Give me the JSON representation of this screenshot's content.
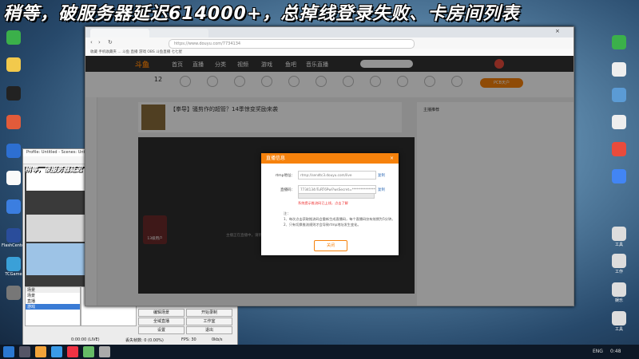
{
  "overlay": {
    "title": "稍等，破服务器延迟614000+，总掉线登录失败、卡房间列表",
    "small_title": "稍等，破服务器延迟"
  },
  "desktop_icons": [
    {
      "label": ""
    },
    {
      "label": ""
    },
    {
      "label": ""
    },
    {
      "label": ""
    },
    {
      "label": ""
    },
    {
      "label": ""
    },
    {
      "label": ""
    },
    {
      "label": ""
    },
    {
      "label": "FlashCenter"
    },
    {
      "label": "TCGame"
    }
  ],
  "desktop_icons_right": [
    {
      "label": ""
    },
    {
      "label": ""
    },
    {
      "label": ""
    },
    {
      "label": ""
    },
    {
      "label": ""
    },
    {
      "label": ""
    },
    {
      "label": "工具"
    },
    {
      "label": "工作"
    },
    {
      "label": "娱乐"
    },
    {
      "label": "工具"
    }
  ],
  "obs": {
    "title": "Profile: Untitled - Scenes: Untitled",
    "scenes_header": "场景",
    "scene_items": [
      "场景",
      "直播",
      "游戏"
    ],
    "buttons": [
      "编辑场景",
      "开始录制",
      "全域直播",
      "工作室",
      "设置",
      "退出"
    ],
    "status": [
      "0:00:00 (LIVE)",
      "丢失帧数: 0 (0.00%)",
      "FPS: 30",
      "0kb/s"
    ]
  },
  "browser": {
    "url": "https://www.douyu.com/7734134",
    "tab_label": "",
    "bookmarks": "收藏  手机收藏夹  ...  斗鱼  直播  游戏  OBS  斗鱼直播  七七星",
    "nav": {
      "logo": "斗鱼",
      "links": [
        "首页",
        "直播",
        "分类",
        "视频",
        "游戏",
        "鱼吧",
        "音乐直播"
      ]
    },
    "categories": [
      "12",
      "",
      "",
      "",
      "",
      "",
      "",
      "",
      "",
      "",
      "",
      "",
      "",
      "",
      "",
      ""
    ],
    "stream_title": "【拳导】骚剪作的超管？14季惊变奖励来袭",
    "chat_header": "主播推荐",
    "right_pill": "PCB天户",
    "video_watermark": "主播正在直播中，请稍后刷新",
    "badge": "13级用户"
  },
  "dialog": {
    "title": "直播信息",
    "close_icon": "×",
    "rtmp_label": "rtmp地址：",
    "rtmp_value": "rtmp://sendtc3.douyu.com/live",
    "key_label": "直播码：",
    "key_value": "7734134rTuRT6Pwl?wsSecret=**************",
    "copy_label": "复制",
    "warning": "系统提示推流码已上线，点击了解",
    "notes": [
      "注：",
      "1、每次点击获取推流码会重新生成直播码，每个直播码仅有效期为5分钟。",
      "2、只有切换推流规则才会导致rtmp地址发生变化。"
    ],
    "close_button": "关闭"
  },
  "taskbar": {
    "lang": "ENG",
    "time": "0:48"
  },
  "colors": {
    "accent": "#f6820c",
    "nav_bg": "#333333",
    "desktop": "#27496b"
  }
}
